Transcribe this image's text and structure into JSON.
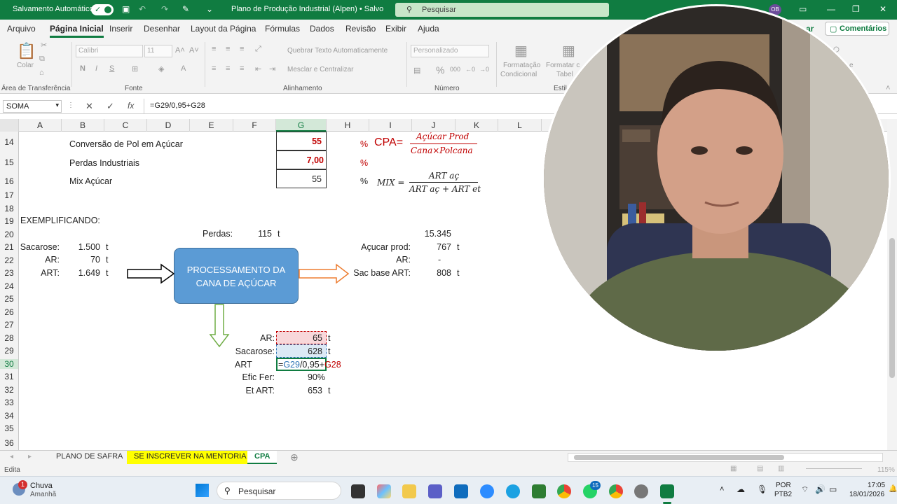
{
  "titlebar": {
    "autosave_label": "Salvamento Automático",
    "doc_title": "Plano de Produção Industrial (Alpen) • Salvo",
    "search_placeholder": "Pesquisar",
    "user_initials": "OB"
  },
  "menu": {
    "items": [
      "Arquivo",
      "Página Inicial",
      "Inserir",
      "Desenhar",
      "Layout da Página",
      "Fórmulas",
      "Dados",
      "Revisão",
      "Exibir",
      "Ajuda"
    ],
    "share_fragment": "ar",
    "comments_label": "Comentários"
  },
  "ribbon": {
    "paste": "Colar",
    "clipboard_group": "Área de Transferência",
    "font_name": "Calibri",
    "font_size": "11",
    "font_group": "Fonte",
    "bold": "N",
    "italic": "I",
    "underline": "S",
    "wrap_text": "Quebrar Texto Automaticamente",
    "merge_center": "Mesclar e Centralizar",
    "alignment_group": "Alinhamento",
    "number_format": "Personalizado",
    "number_group": "Número",
    "cond_format_1": "Formatação",
    "cond_format_2": "Condicional",
    "format_table_1": "Formatar c",
    "format_table_2": "Tabel",
    "styles_group_fragment": "Estil",
    "right_fragment": "e"
  },
  "formula_bar": {
    "name_box": "SOMA",
    "fx": "fx",
    "formula": "=G29/0,95+G28"
  },
  "columns": [
    "A",
    "B",
    "C",
    "D",
    "E",
    "F",
    "G",
    "H",
    "I",
    "J",
    "K",
    "L"
  ],
  "rows": [
    "14",
    "15",
    "16",
    "17",
    "18",
    "19",
    "20",
    "21",
    "22",
    "23",
    "24",
    "25",
    "26",
    "27",
    "28",
    "29",
    "30",
    "31",
    "32",
    "33",
    "34",
    "35",
    "36"
  ],
  "sheet": {
    "conv_label": "Conversão de Pol em Açúcar",
    "conv_value": "55",
    "perdas_ind_label": "Perdas Industriais",
    "perdas_ind_value": "7,00",
    "mix_label": "Mix Açúcar",
    "mix_value": "55",
    "pct1": "%",
    "pct2": "%",
    "pct3": "%",
    "cpa_label": "CPA=",
    "cpa_num": "Açúcar Prod",
    "cpa_den": "Cana×Polcana",
    "mix_eq_label": "MIX =",
    "mix_num": "ART aç",
    "mix_den": "ART aç + ART et",
    "exemplificando": "EXEMPLIFICANDO:",
    "perdas_label": "Perdas:",
    "perdas_value": "115",
    "t": "t",
    "top_value": "15.345",
    "sacarose_label": "Sacarose:",
    "sacarose_value": "1.500",
    "ar_label": "AR:",
    "ar_value": "70",
    "art_label": "ART:",
    "art_value": "1.649",
    "process_line1": "PROCESSAMENTO DA",
    "process_line2": "CANA DE AÇÚCAR",
    "acucar_prod_label": "Açucar prod:",
    "acucar_prod_value": "767",
    "ar_out_label": "AR:",
    "ar_out_value": "-",
    "sac_base_label": "Sac base ART:",
    "sac_base_value": "808",
    "ar28_label": "AR:",
    "ar28_value": "65",
    "sac29_label": "Sacarose:",
    "sac29_value": "628",
    "art30_label": "ART",
    "art30_formula_a": "=",
    "art30_formula_b": "G29",
    "art30_formula_c": "/0,95+",
    "art30_formula_d": "G28",
    "efic_label": "Efic Fer:",
    "efic_value": "90%",
    "etart_label": "Et ART:",
    "etart_value": "653"
  },
  "tabs": [
    "PLANO DE SAFRA",
    "SE INSCREVER NA MENTORIA",
    "CPA"
  ],
  "status": {
    "mode": "Edita",
    "zoom": "115%"
  },
  "taskbar": {
    "weather_title": "Chuva",
    "weather_sub": "Amanhã",
    "weather_badge": "1",
    "search": "Pesquisar",
    "lang1": "POR",
    "lang2": "PTB2",
    "time": "17:05",
    "date": "18/01/2026",
    "whatsapp_badge": "15"
  },
  "colors": {
    "excel_green": "#107c41",
    "shape_blue": "#5b9bd5",
    "red_value": "#c00000",
    "tab_yellow": "#ffff00"
  }
}
